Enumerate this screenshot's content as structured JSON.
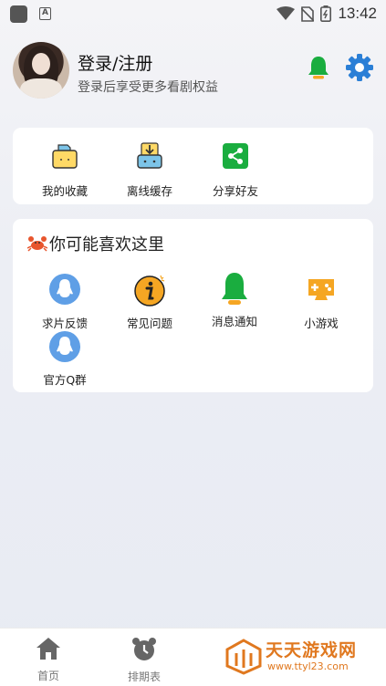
{
  "status_bar": {
    "time": "13:42",
    "badge_letter": "A"
  },
  "profile": {
    "title": "登录/注册",
    "subtitle": "登录后享受更多看剧权益"
  },
  "quick_actions": [
    {
      "label": "我的收藏",
      "icon": "folder-icon"
    },
    {
      "label": "离线缓存",
      "icon": "download-icon"
    },
    {
      "label": "分享好友",
      "icon": "share-icon"
    }
  ],
  "recommend": {
    "title": "你可能喜欢这里",
    "items": [
      {
        "label": "求片反馈",
        "icon": "qq-penguin-icon"
      },
      {
        "label": "常见问题",
        "icon": "info-icon"
      },
      {
        "label": "消息通知",
        "icon": "bell-icon"
      },
      {
        "label": "小游戏",
        "icon": "gamepad-icon"
      },
      {
        "label": "官方Q群",
        "icon": "qq-penguin-icon"
      }
    ]
  },
  "bottom_nav": [
    {
      "label": "首页",
      "icon": "home-icon"
    },
    {
      "label": "排期表",
      "icon": "alarm-clock-icon"
    }
  ],
  "watermark": {
    "title": "天天游戏网",
    "url": "www.ttyl23.com"
  },
  "colors": {
    "green": "#1aad3f",
    "blue": "#2b7fd6",
    "orange": "#e0781f",
    "qq_blue": "#5f9fe6"
  }
}
